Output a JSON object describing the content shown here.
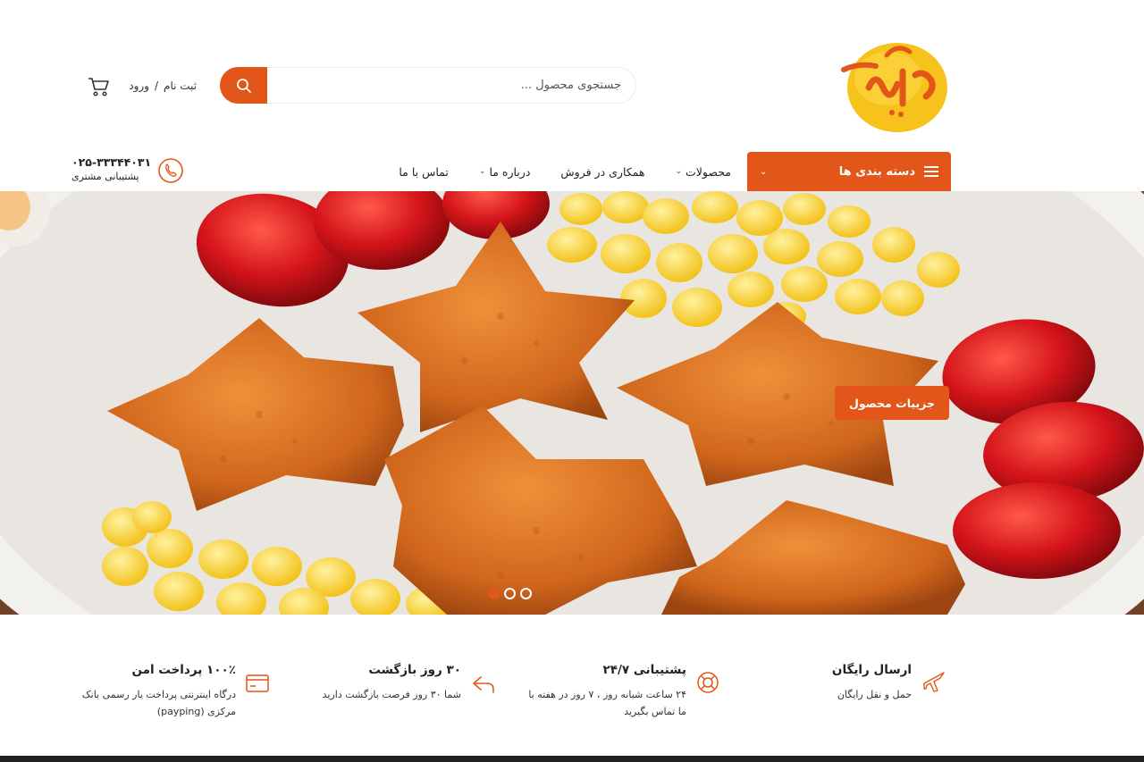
{
  "header": {
    "search": {
      "placeholder": "جستجوی محصول ..."
    },
    "auth": {
      "register": "ثبت نام",
      "separator": "/",
      "login": "ورود"
    }
  },
  "nav": {
    "categories_label": "دسته بندی ها",
    "items": [
      {
        "label": "محصولات",
        "has_dropdown": true
      },
      {
        "label": "همکاری در فروش",
        "has_dropdown": false
      },
      {
        "label": "درباره ما",
        "has_dropdown": true
      },
      {
        "label": "تماس با ما",
        "has_dropdown": false
      }
    ],
    "support": {
      "phone": "۰۲۵-۳۳۳۴۴۰۳۱",
      "label": "پشتیبانی مشتری"
    }
  },
  "hero": {
    "button_label": "جزییات محصول",
    "slides": 3,
    "active_slide": 1
  },
  "features": [
    {
      "icon": "airplane-icon",
      "title": "ارسال رایگان",
      "desc": "حمل و نقل رایگان"
    },
    {
      "icon": "lifebuoy-icon",
      "title": "پشتیبانی ۲۴/۷",
      "desc": "۲۴ ساعت شبانه روز ، ۷ روز در هفته با ما تماس بگیرید"
    },
    {
      "icon": "return-arrow-icon",
      "title": "۳۰ روز بازگشت",
      "desc": "شما ۳۰ روز فرصت بازگشت دارید"
    },
    {
      "icon": "credit-card-icon",
      "title": "۱۰۰٪ پرداخت امن",
      "desc": "درگاه اینترنتی پرداخت یار رسمی بانک مرکزی (payping)"
    }
  ],
  "colors": {
    "accent": "#e2561a",
    "text": "#222222"
  }
}
